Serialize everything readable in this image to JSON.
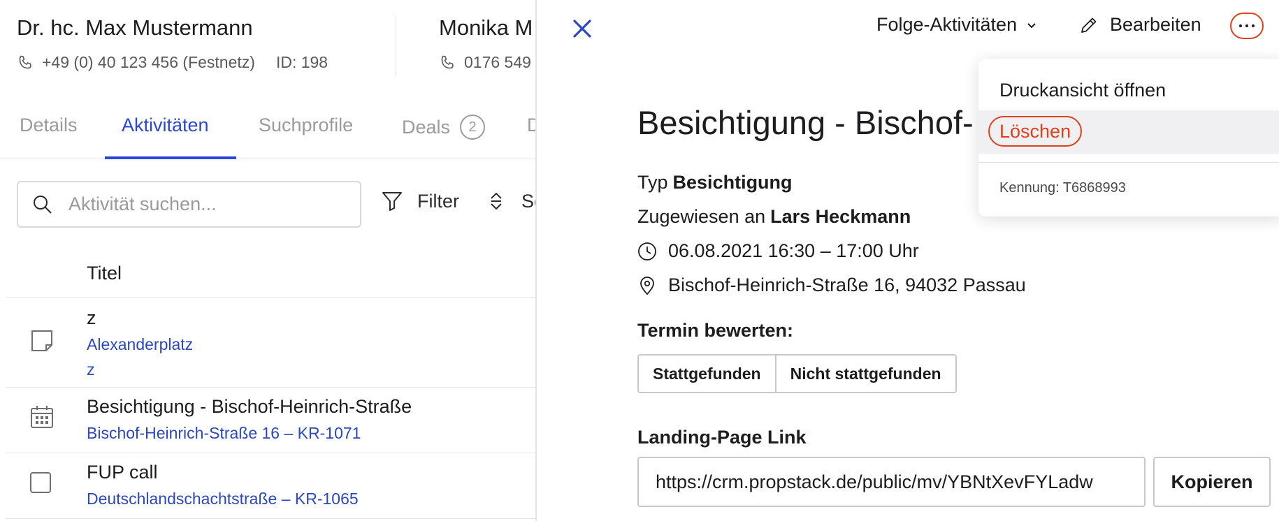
{
  "contacts": [
    {
      "name": "Dr. hc. Max Mustermann",
      "phone": "+49 (0) 40 123 456 (Festnetz)",
      "id": "ID: 198"
    },
    {
      "name": "Monika M",
      "phone": "0176 549"
    }
  ],
  "tabs": [
    {
      "label": "Details",
      "active": false
    },
    {
      "label": "Aktivitäten",
      "active": true
    },
    {
      "label": "Suchprofile",
      "active": false
    },
    {
      "label": "Deals",
      "badge": "2",
      "active": false
    },
    {
      "label": "D",
      "active": false
    }
  ],
  "search": {
    "placeholder": "Aktivität suchen..."
  },
  "toolbar": {
    "filter_label": "Filter",
    "sort_label": "So"
  },
  "list": {
    "column_title": "Titel",
    "rows": [
      {
        "icon": "note-icon",
        "title": "z",
        "subtitle": "Alexanderplatz",
        "extra": "z"
      },
      {
        "icon": "calendar-icon",
        "title": "Besichtigung - Bischof-Heinrich-Straße",
        "subtitle": "Bischof-Heinrich-Straße 16 – KR-1071"
      },
      {
        "icon": "checkbox-icon",
        "title": "FUP call",
        "subtitle": "Deutschlandschachtstraße – KR-1065"
      }
    ]
  },
  "detail": {
    "header": {
      "follow_up_label": "Folge-Aktivitäten",
      "edit_label": "Bearbeiten"
    },
    "title": "Besichtigung - Bischof-",
    "type_label": "Typ",
    "type_value": "Besichtigung",
    "assigned_label": "Zugewiesen an",
    "assigned_value": "Lars Heckmann",
    "datetime": "06.08.2021 16:30 – 17:00 Uhr",
    "address": "Bischof-Heinrich-Straße 16, 94032 Passau",
    "rate_heading": "Termin bewerten:",
    "rate_options": [
      "Stattgefunden",
      "Nicht stattgefunden"
    ],
    "landing_heading": "Landing-Page Link",
    "landing_url": "https://crm.propstack.de/public/mv/YBNtXevFYLadw",
    "copy_label": "Kopieren"
  },
  "menu": {
    "print_label": "Druckansicht öffnen",
    "delete_label": "Löschen",
    "identifier": "Kennung: T6868993"
  },
  "colors": {
    "accent": "#2b47d9",
    "link": "#2b47c2",
    "highlight": "#e2401c"
  }
}
